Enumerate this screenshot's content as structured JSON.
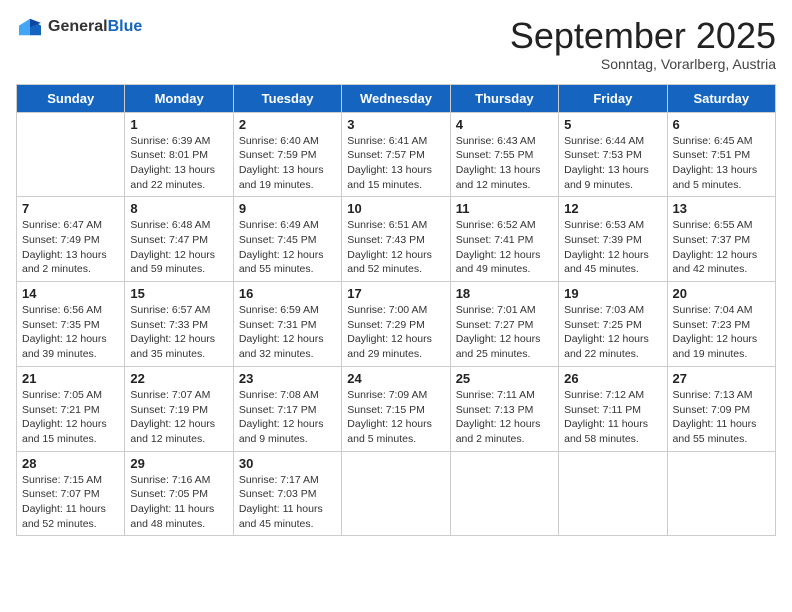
{
  "logo": {
    "general": "General",
    "blue": "Blue"
  },
  "header": {
    "month": "September 2025",
    "location": "Sonntag, Vorarlberg, Austria"
  },
  "weekdays": [
    "Sunday",
    "Monday",
    "Tuesday",
    "Wednesday",
    "Thursday",
    "Friday",
    "Saturday"
  ],
  "weeks": [
    [
      {
        "day": "",
        "info": ""
      },
      {
        "day": "1",
        "info": "Sunrise: 6:39 AM\nSunset: 8:01 PM\nDaylight: 13 hours\nand 22 minutes."
      },
      {
        "day": "2",
        "info": "Sunrise: 6:40 AM\nSunset: 7:59 PM\nDaylight: 13 hours\nand 19 minutes."
      },
      {
        "day": "3",
        "info": "Sunrise: 6:41 AM\nSunset: 7:57 PM\nDaylight: 13 hours\nand 15 minutes."
      },
      {
        "day": "4",
        "info": "Sunrise: 6:43 AM\nSunset: 7:55 PM\nDaylight: 13 hours\nand 12 minutes."
      },
      {
        "day": "5",
        "info": "Sunrise: 6:44 AM\nSunset: 7:53 PM\nDaylight: 13 hours\nand 9 minutes."
      },
      {
        "day": "6",
        "info": "Sunrise: 6:45 AM\nSunset: 7:51 PM\nDaylight: 13 hours\nand 5 minutes."
      }
    ],
    [
      {
        "day": "7",
        "info": "Sunrise: 6:47 AM\nSunset: 7:49 PM\nDaylight: 13 hours\nand 2 minutes."
      },
      {
        "day": "8",
        "info": "Sunrise: 6:48 AM\nSunset: 7:47 PM\nDaylight: 12 hours\nand 59 minutes."
      },
      {
        "day": "9",
        "info": "Sunrise: 6:49 AM\nSunset: 7:45 PM\nDaylight: 12 hours\nand 55 minutes."
      },
      {
        "day": "10",
        "info": "Sunrise: 6:51 AM\nSunset: 7:43 PM\nDaylight: 12 hours\nand 52 minutes."
      },
      {
        "day": "11",
        "info": "Sunrise: 6:52 AM\nSunset: 7:41 PM\nDaylight: 12 hours\nand 49 minutes."
      },
      {
        "day": "12",
        "info": "Sunrise: 6:53 AM\nSunset: 7:39 PM\nDaylight: 12 hours\nand 45 minutes."
      },
      {
        "day": "13",
        "info": "Sunrise: 6:55 AM\nSunset: 7:37 PM\nDaylight: 12 hours\nand 42 minutes."
      }
    ],
    [
      {
        "day": "14",
        "info": "Sunrise: 6:56 AM\nSunset: 7:35 PM\nDaylight: 12 hours\nand 39 minutes."
      },
      {
        "day": "15",
        "info": "Sunrise: 6:57 AM\nSunset: 7:33 PM\nDaylight: 12 hours\nand 35 minutes."
      },
      {
        "day": "16",
        "info": "Sunrise: 6:59 AM\nSunset: 7:31 PM\nDaylight: 12 hours\nand 32 minutes."
      },
      {
        "day": "17",
        "info": "Sunrise: 7:00 AM\nSunset: 7:29 PM\nDaylight: 12 hours\nand 29 minutes."
      },
      {
        "day": "18",
        "info": "Sunrise: 7:01 AM\nSunset: 7:27 PM\nDaylight: 12 hours\nand 25 minutes."
      },
      {
        "day": "19",
        "info": "Sunrise: 7:03 AM\nSunset: 7:25 PM\nDaylight: 12 hours\nand 22 minutes."
      },
      {
        "day": "20",
        "info": "Sunrise: 7:04 AM\nSunset: 7:23 PM\nDaylight: 12 hours\nand 19 minutes."
      }
    ],
    [
      {
        "day": "21",
        "info": "Sunrise: 7:05 AM\nSunset: 7:21 PM\nDaylight: 12 hours\nand 15 minutes."
      },
      {
        "day": "22",
        "info": "Sunrise: 7:07 AM\nSunset: 7:19 PM\nDaylight: 12 hours\nand 12 minutes."
      },
      {
        "day": "23",
        "info": "Sunrise: 7:08 AM\nSunset: 7:17 PM\nDaylight: 12 hours\nand 9 minutes."
      },
      {
        "day": "24",
        "info": "Sunrise: 7:09 AM\nSunset: 7:15 PM\nDaylight: 12 hours\nand 5 minutes."
      },
      {
        "day": "25",
        "info": "Sunrise: 7:11 AM\nSunset: 7:13 PM\nDaylight: 12 hours\nand 2 minutes."
      },
      {
        "day": "26",
        "info": "Sunrise: 7:12 AM\nSunset: 7:11 PM\nDaylight: 11 hours\nand 58 minutes."
      },
      {
        "day": "27",
        "info": "Sunrise: 7:13 AM\nSunset: 7:09 PM\nDaylight: 11 hours\nand 55 minutes."
      }
    ],
    [
      {
        "day": "28",
        "info": "Sunrise: 7:15 AM\nSunset: 7:07 PM\nDaylight: 11 hours\nand 52 minutes."
      },
      {
        "day": "29",
        "info": "Sunrise: 7:16 AM\nSunset: 7:05 PM\nDaylight: 11 hours\nand 48 minutes."
      },
      {
        "day": "30",
        "info": "Sunrise: 7:17 AM\nSunset: 7:03 PM\nDaylight: 11 hours\nand 45 minutes."
      },
      {
        "day": "",
        "info": ""
      },
      {
        "day": "",
        "info": ""
      },
      {
        "day": "",
        "info": ""
      },
      {
        "day": "",
        "info": ""
      }
    ]
  ]
}
